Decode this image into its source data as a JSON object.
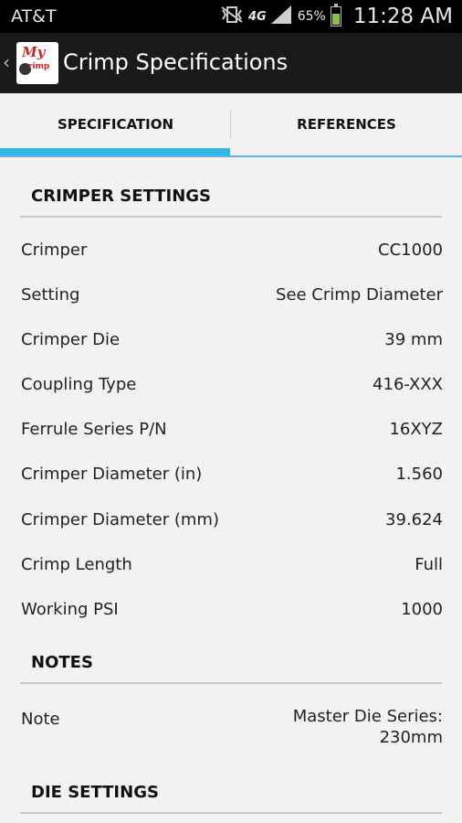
{
  "status_bar": {
    "carrier": "AT&T",
    "network": "4G",
    "battery": "65%",
    "time": "11:28 AM"
  },
  "header": {
    "back_glyph": "‹",
    "logo_text_top": "My",
    "logo_text_bottom": "rimp",
    "title": "Crimp Specifications"
  },
  "tabs": [
    {
      "label": "SPECIFICATION",
      "selected": true
    },
    {
      "label": "REFERENCES",
      "selected": false
    }
  ],
  "crimper_settings": {
    "heading": "CRIMPER SETTINGS",
    "rows": [
      {
        "label": "Crimper",
        "value": "CC1000"
      },
      {
        "label": "Setting",
        "value": "See Crimp Diameter"
      },
      {
        "label": "Crimper Die",
        "value": "39 mm"
      },
      {
        "label": "Coupling Type",
        "value": "416-XXX"
      },
      {
        "label": "Ferrule Series P/N",
        "value": "16XYZ"
      },
      {
        "label": "Crimper Diameter (in)",
        "value": "1.560"
      },
      {
        "label": "Crimper Diameter (mm)",
        "value": "39.624"
      },
      {
        "label": "Crimp Length",
        "value": "Full"
      },
      {
        "label": "Working PSI",
        "value": "1000"
      }
    ]
  },
  "notes": {
    "heading": "NOTES",
    "label": "Note",
    "value": "Master Die Series: 230mm"
  },
  "die_settings": {
    "heading": "DIE SETTINGS"
  },
  "colors": {
    "accent": "#33b5e5",
    "action_bar": "#1a1a1a",
    "background": "#f2f2f2",
    "battery": "#8bc34a"
  },
  "icons": [
    "no-vibrate-icon",
    "signal-icon",
    "battery-icon",
    "back-icon",
    "app-logo"
  ]
}
